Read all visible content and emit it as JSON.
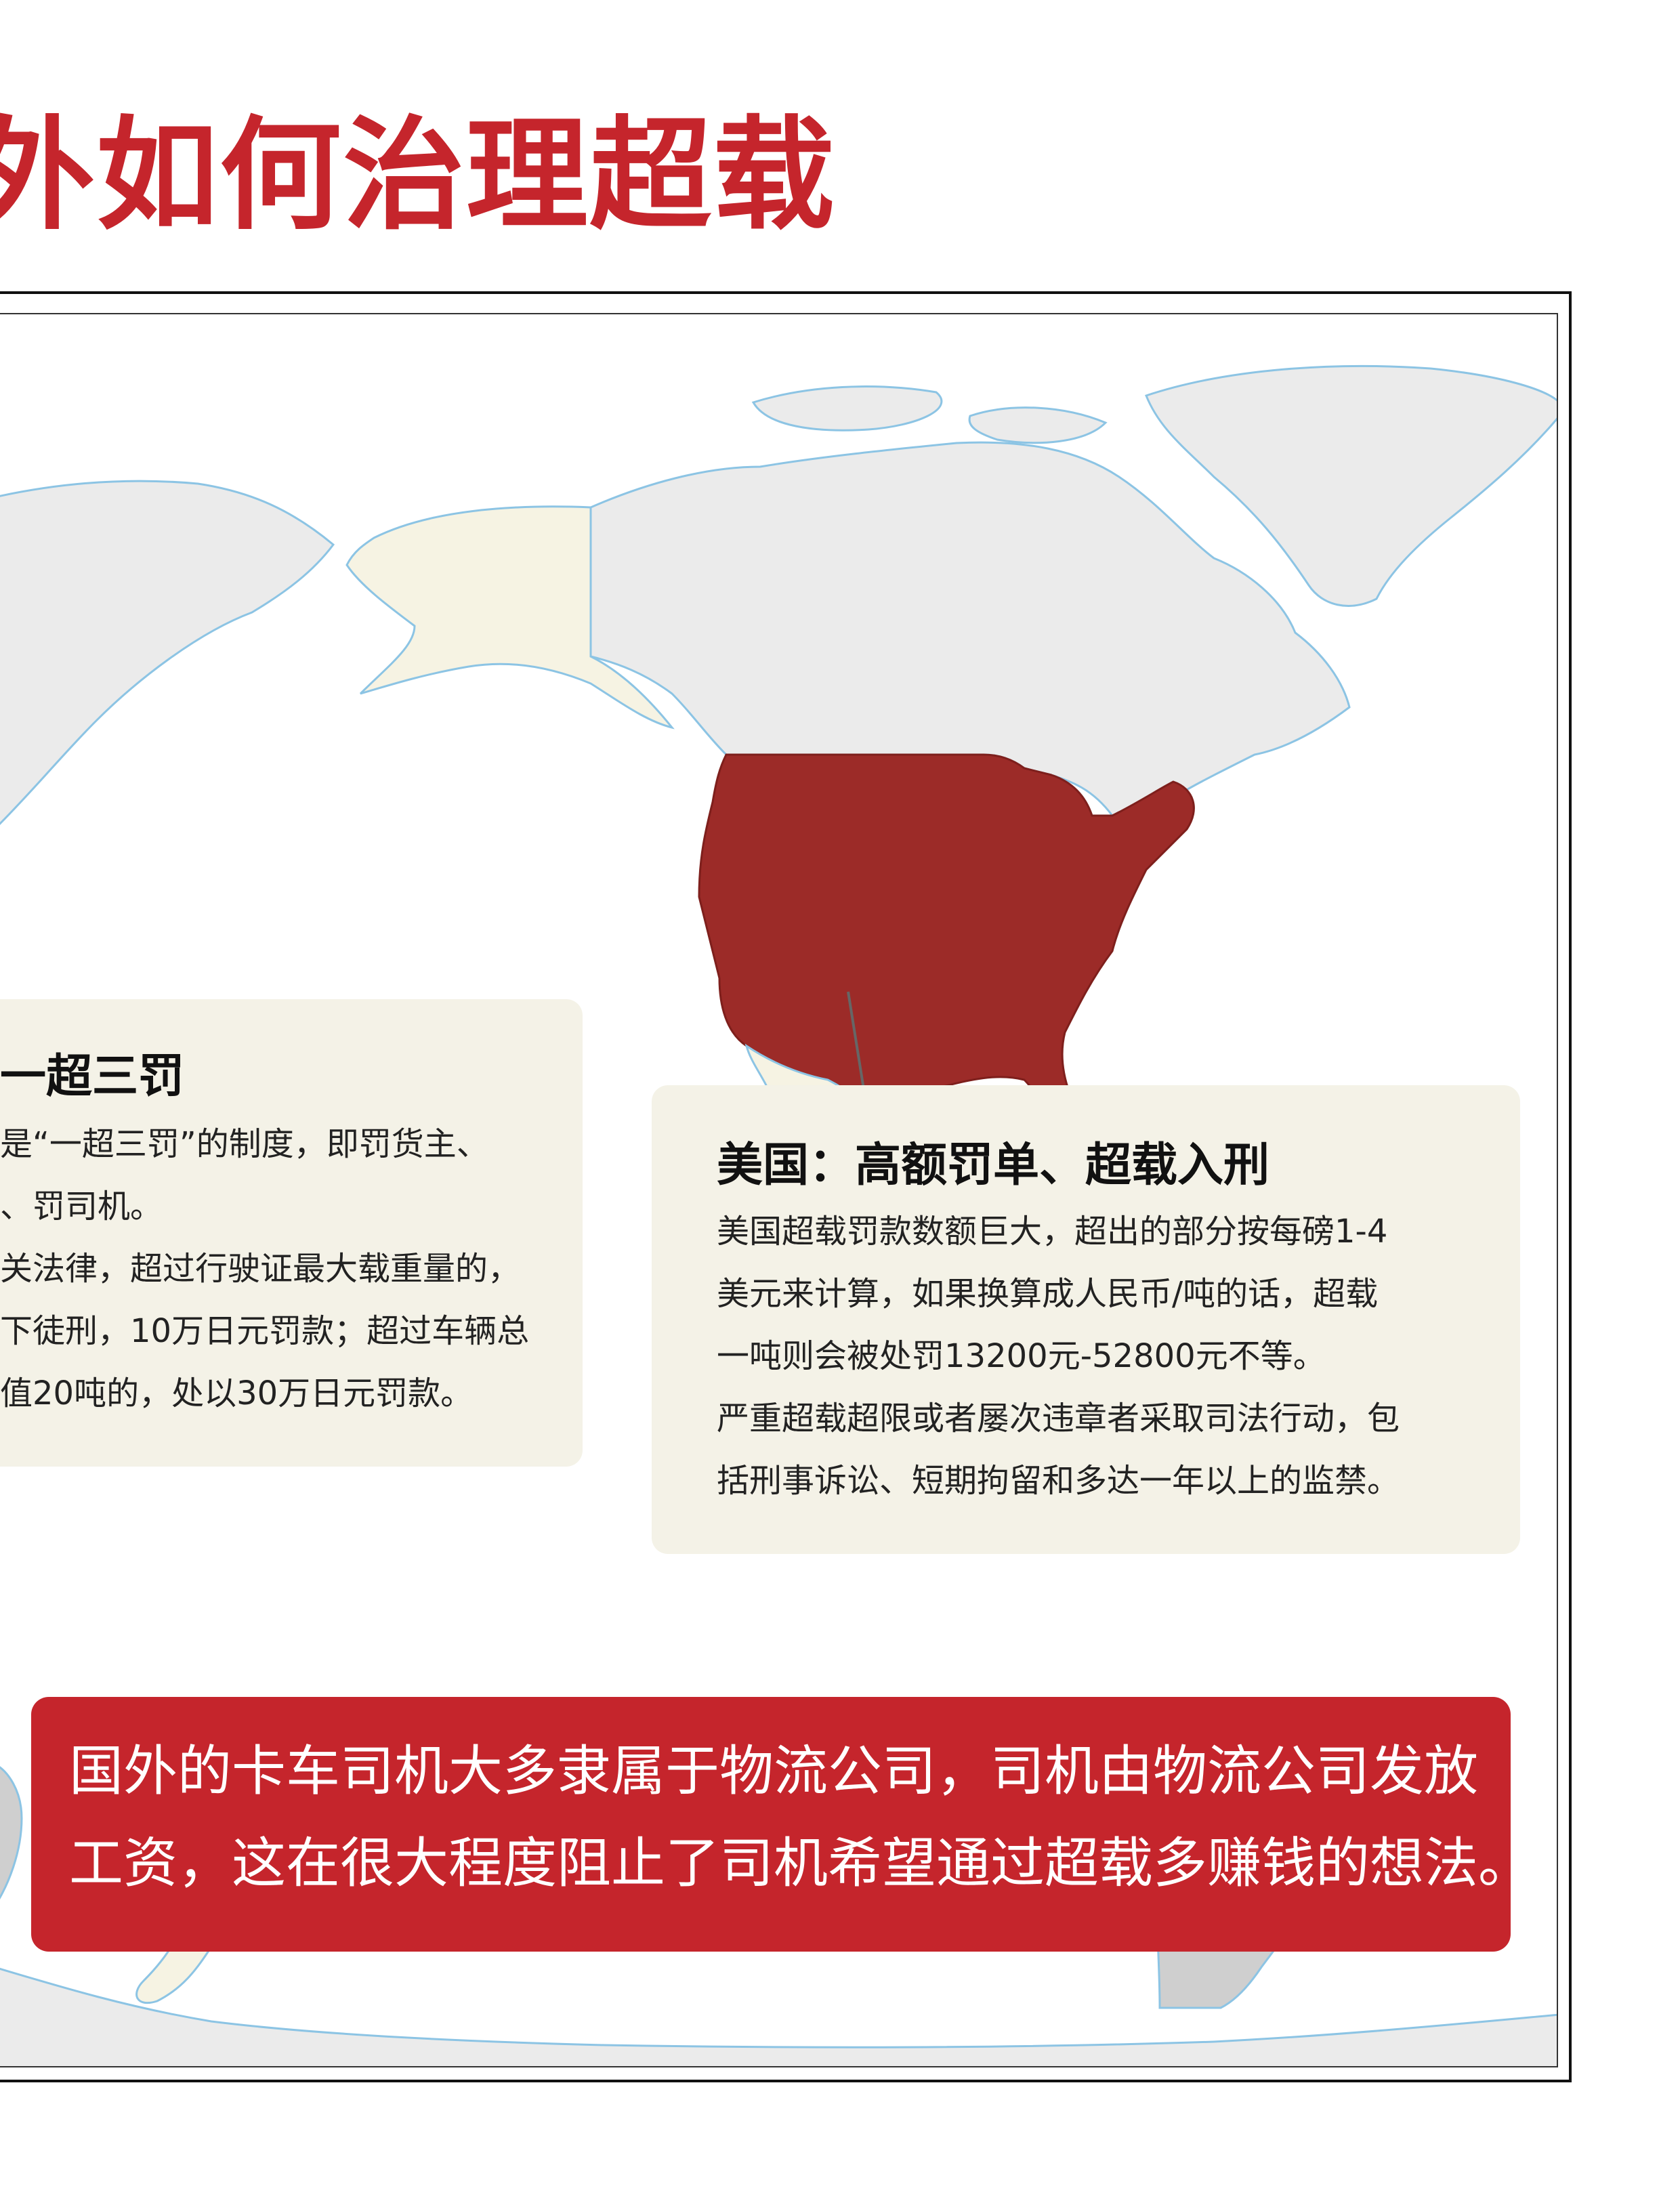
{
  "page": {
    "title": "外如何治理超载"
  },
  "japan_card": {
    "heading": "一超三罚",
    "lines": [
      "是“一超三罚”的制度，即罚货主、",
      "、罚司机。",
      "关法律，超过行驶证最大载重量的，",
      "下徒刑，10万日元罚款；超过车辆总",
      "值20吨的，处以30万日元罚款。"
    ]
  },
  "usa_card": {
    "heading": "美国：高额罚单、超载入刑",
    "lines": [
      "美国超载罚款数额巨大，超出的部分按每磅1-4",
      "美元来计算，如果换算成人民币/吨的话，超载",
      "一吨则会被处罚13200元-52800元不等。",
      "严重超载超限或者屡次违章者采取司法行动，包",
      "括刑事诉讼、短期拘留和多达一年以上的监禁。"
    ]
  },
  "banner": {
    "lines": [
      "国外的卡车司机大多隶属于物流公司，司机由物流公司发放",
      "工资，这在很大程度阻止了司机希望通过超载多赚钱的想法。"
    ]
  },
  "map": {
    "highlighted_country": "United States",
    "colors": {
      "highlight": "#9c2b28",
      "land": "#ebebeb",
      "neighbor": "#f6f3e3",
      "coast": "#8cc4e4",
      "accent": "#c5252c"
    }
  }
}
